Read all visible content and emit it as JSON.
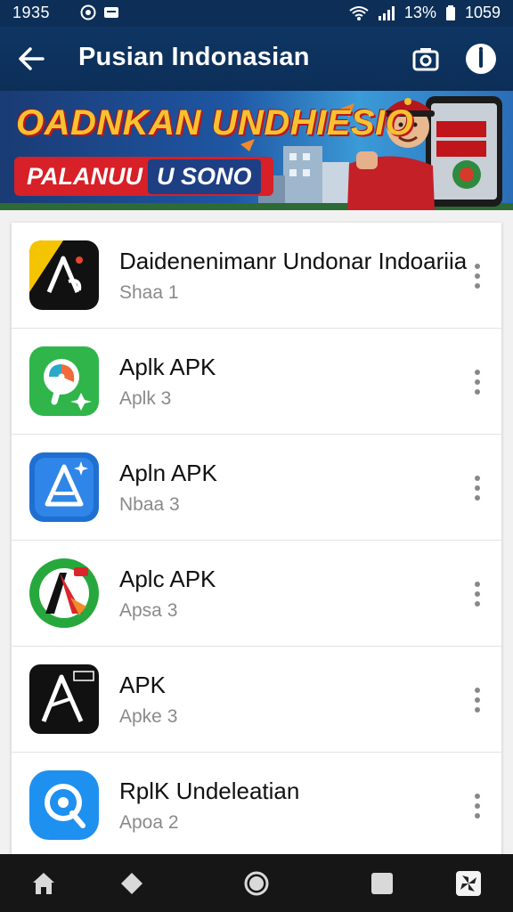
{
  "status_bar": {
    "time": "1935",
    "battery_percent": "13%",
    "clock_right": "1059",
    "icons": [
      "whatsapp-icon",
      "message-icon",
      "wifi-icon",
      "signal-icon",
      "battery-icon"
    ]
  },
  "app_bar": {
    "title": "Pusian Indonasian",
    "icons": [
      "back-arrow-icon",
      "camera-icon",
      "info-icon"
    ]
  },
  "banner": {
    "headline": "OADNKAN UNDHIESIO",
    "tag_main": "PALANUU",
    "tag_tail": "U SONO"
  },
  "apps": [
    {
      "name": "Daidenenimanr Undonar Indoariia",
      "subtitle": "Shaa 1",
      "icon": "black-yellow-logo-icon"
    },
    {
      "name": "Aplk APK",
      "subtitle": "Aplk 3",
      "icon": "green-p-logo-icon"
    },
    {
      "name": "Apln APK",
      "subtitle": "Nbaa 3",
      "icon": "blue-a-logo-icon"
    },
    {
      "name": "Aplc APK",
      "subtitle": "Apsa 3",
      "icon": "red-green-logo-icon"
    },
    {
      "name": "APK",
      "subtitle": "Apke 3",
      "icon": "black-a-logo-icon"
    },
    {
      "name": "RplK Undeleatian",
      "subtitle": "Apoa 2",
      "icon": "blue-q-logo-icon"
    }
  ],
  "nav_bar": {
    "items": [
      "home-icon",
      "diamond-icon",
      "circle-icon",
      "square-icon",
      "pinwheel-icon"
    ]
  },
  "colors": {
    "app_bar": "#0d2f57",
    "background": "#f1f1f1",
    "nav_bar": "#161616",
    "headline": "#f6c230",
    "accent_red": "#d72027"
  }
}
